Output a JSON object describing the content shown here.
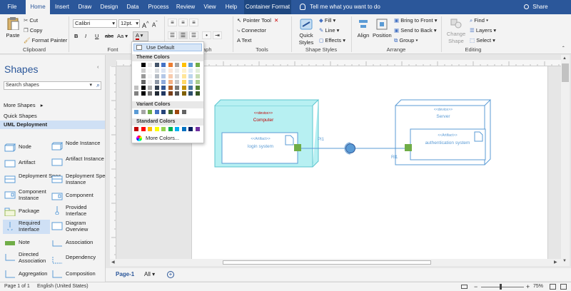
{
  "tabs": [
    "File",
    "Home",
    "Insert",
    "Draw",
    "Design",
    "Data",
    "Process",
    "Review",
    "View",
    "Help",
    "Container Format"
  ],
  "tell_me": "Tell me what you want to do",
  "share": "Share",
  "clipboard": {
    "paste": "Paste",
    "cut": "Cut",
    "copy": "Copy",
    "format_painter": "Format Painter",
    "label": "Clipboard"
  },
  "font": {
    "family": "Calibri",
    "size": "12pt.",
    "label": "Font"
  },
  "paragraph": {
    "label": "Paragraph"
  },
  "tools": {
    "pointer": "Pointer Tool",
    "connector": "Connector",
    "text": "Text",
    "label": "Tools"
  },
  "shape_styles": {
    "quick_styles": "Quick Styles",
    "fill": "Fill",
    "line": "Line",
    "effects": "Effects",
    "label": "Shape Styles"
  },
  "arrange": {
    "align": "Align",
    "position": "Position",
    "bring_front": "Bring to Front",
    "send_back": "Send to Back",
    "group": "Group",
    "label": "Arrange"
  },
  "editing": {
    "change_shape": "Change Shape",
    "find": "Find",
    "layers": "Layers",
    "select": "Select",
    "label": "Editing"
  },
  "palette": {
    "use_default": "Use Default",
    "theme_colors": "Theme Colors",
    "variant_colors": "Variant Colors",
    "standard_colors": "Standard Colors",
    "more_colors": "More Colors...",
    "theme_top": [
      "#ffffff",
      "#000000",
      "#e7e6e6",
      "#44546a",
      "#4472c4",
      "#ed7d31",
      "#a5a5a5",
      "#ffc000",
      "#5b9bd5",
      "#70ad47"
    ],
    "variant": [
      "#5b9bd5",
      "#a5a5a5",
      "#70ad47",
      "#4472c4",
      "#264478",
      "#43682b",
      "#9e480e",
      "#636363"
    ],
    "standard": [
      "#c00000",
      "#ff0000",
      "#ffc000",
      "#ffff00",
      "#92d050",
      "#00b050",
      "#00b0f0",
      "#0070c0",
      "#002060",
      "#7030a0"
    ]
  },
  "shapes_pane": {
    "title": "Shapes",
    "search_placeholder": "Search shapes",
    "more_shapes": "More Shapes",
    "quick_shapes": "Quick Shapes",
    "uml_deployment": "UML Deployment",
    "items": [
      {
        "label": "Node"
      },
      {
        "label": "Node Instance"
      },
      {
        "label": "Artifact"
      },
      {
        "label": "Artifact Instance"
      },
      {
        "label": "Deployment Spec"
      },
      {
        "label": "Deployment Spec Instance"
      },
      {
        "label": "Component Instance"
      },
      {
        "label": "Component"
      },
      {
        "label": "Package"
      },
      {
        "label": "Provided Interface"
      },
      {
        "label": "Required Interface"
      },
      {
        "label": "Diagram Overview"
      },
      {
        "label": "Note"
      },
      {
        "label": "Association"
      },
      {
        "label": "Directed Association"
      },
      {
        "label": "Dependency"
      },
      {
        "label": "Aggregation"
      },
      {
        "label": "Composition"
      }
    ]
  },
  "diagram": {
    "computer": {
      "stereo": "<<device>>",
      "name": "Computer"
    },
    "login": {
      "stereo": "<<Artifact>>",
      "name": "login system"
    },
    "server": {
      "stereo": "<<device>>",
      "name": "Server"
    },
    "auth": {
      "stereo": "<<Artifact>>",
      "name": "authentication system"
    },
    "label_pi": "PI1",
    "label_ri": "RI1"
  },
  "page_tabs": {
    "page1": "Page-1",
    "all": "All"
  },
  "status": {
    "page": "Page 1 of 1",
    "language": "English (United States)",
    "zoom": "75%"
  },
  "colors": {
    "accent": "#2b579a",
    "container_fill": "#b7f0f2",
    "line_blue": "#5b9bd5",
    "port_green": "#70ad47"
  }
}
